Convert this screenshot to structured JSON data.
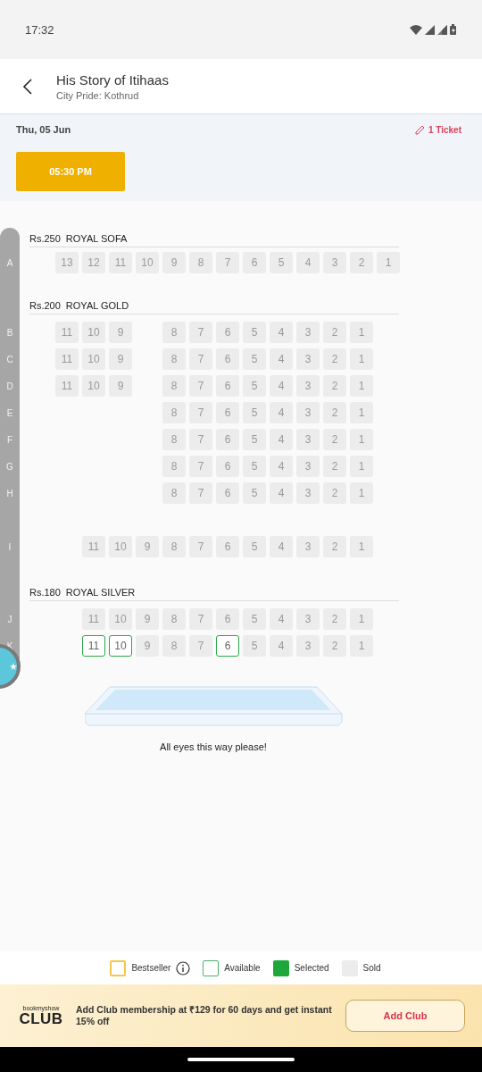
{
  "status_bar": {
    "time": "17:32"
  },
  "header": {
    "title": "His Story of Itihaas",
    "subtitle": "City Pride: Kothrud"
  },
  "show": {
    "date": "Thu, 05 Jun",
    "tickets": "1 Ticket",
    "showtimes": [
      {
        "time": "05:30 PM",
        "selected": true
      }
    ]
  },
  "sections": [
    {
      "price": "Rs.250",
      "name": "ROYAL SOFA",
      "rows": [
        {
          "kind": "seats",
          "letter": "A",
          "seats": [
            {
              "kind": "seat",
              "label": "13",
              "sold": true
            },
            {
              "kind": "seat",
              "label": "12",
              "sold": true
            },
            {
              "kind": "seat",
              "label": "11",
              "sold": true
            },
            {
              "kind": "seat",
              "label": "10",
              "sold": true
            },
            {
              "kind": "seat",
              "label": "9",
              "sold": true
            },
            {
              "kind": "seat",
              "label": "8",
              "sold": true
            },
            {
              "kind": "seat",
              "label": "7",
              "sold": true
            },
            {
              "kind": "seat",
              "label": "6",
              "sold": true
            },
            {
              "kind": "seat",
              "label": "5",
              "sold": true
            },
            {
              "kind": "seat",
              "label": "4",
              "sold": true
            },
            {
              "kind": "seat",
              "label": "3",
              "sold": true
            },
            {
              "kind": "seat",
              "label": "2",
              "sold": true
            },
            {
              "kind": "seat",
              "label": "1",
              "sold": true
            }
          ]
        }
      ]
    },
    {
      "price": "Rs.200",
      "name": "ROYAL GOLD",
      "rows": [
        {
          "kind": "seats",
          "letter": "B",
          "seats": [
            {
              "kind": "seat",
              "label": "11",
              "sold": true
            },
            {
              "kind": "seat",
              "label": "10",
              "sold": true
            },
            {
              "kind": "seat",
              "label": "9",
              "sold": true
            },
            {
              "kind": "gap"
            },
            {
              "kind": "seat",
              "label": "8",
              "sold": true
            },
            {
              "kind": "seat",
              "label": "7",
              "sold": true
            },
            {
              "kind": "seat",
              "label": "6",
              "sold": true
            },
            {
              "kind": "seat",
              "label": "5",
              "sold": true
            },
            {
              "kind": "seat",
              "label": "4",
              "sold": true
            },
            {
              "kind": "seat",
              "label": "3",
              "sold": true
            },
            {
              "kind": "seat",
              "label": "2",
              "sold": true
            },
            {
              "kind": "seat",
              "label": "1",
              "sold": true
            }
          ]
        },
        {
          "kind": "seats",
          "letter": "C",
          "seats": [
            {
              "kind": "seat",
              "label": "11",
              "sold": true
            },
            {
              "kind": "seat",
              "label": "10",
              "sold": true
            },
            {
              "kind": "seat",
              "label": "9",
              "sold": true
            },
            {
              "kind": "gap"
            },
            {
              "kind": "seat",
              "label": "8",
              "sold": true
            },
            {
              "kind": "seat",
              "label": "7",
              "sold": true
            },
            {
              "kind": "seat",
              "label": "6",
              "sold": true
            },
            {
              "kind": "seat",
              "label": "5",
              "sold": true
            },
            {
              "kind": "seat",
              "label": "4",
              "sold": true
            },
            {
              "kind": "seat",
              "label": "3",
              "sold": true
            },
            {
              "kind": "seat",
              "label": "2",
              "sold": true
            },
            {
              "kind": "seat",
              "label": "1",
              "sold": true
            }
          ]
        },
        {
          "kind": "seats",
          "letter": "D",
          "seats": [
            {
              "kind": "seat",
              "label": "11",
              "sold": true
            },
            {
              "kind": "seat",
              "label": "10",
              "sold": true
            },
            {
              "kind": "seat",
              "label": "9",
              "sold": true
            },
            {
              "kind": "gap"
            },
            {
              "kind": "seat",
              "label": "8",
              "sold": true
            },
            {
              "kind": "seat",
              "label": "7",
              "sold": true
            },
            {
              "kind": "seat",
              "label": "6",
              "sold": true
            },
            {
              "kind": "seat",
              "label": "5",
              "sold": true
            },
            {
              "kind": "seat",
              "label": "4",
              "sold": true
            },
            {
              "kind": "seat",
              "label": "3",
              "sold": true
            },
            {
              "kind": "seat",
              "label": "2",
              "sold": true
            },
            {
              "kind": "seat",
              "label": "1",
              "sold": true
            }
          ]
        },
        {
          "kind": "seats",
          "letter": "E",
          "seats": [
            {
              "kind": "gap"
            },
            {
              "kind": "gap"
            },
            {
              "kind": "gap"
            },
            {
              "kind": "gap"
            },
            {
              "kind": "seat",
              "label": "8",
              "sold": true
            },
            {
              "kind": "seat",
              "label": "7",
              "sold": true
            },
            {
              "kind": "seat",
              "label": "6",
              "sold": true
            },
            {
              "kind": "seat",
              "label": "5",
              "sold": true
            },
            {
              "kind": "seat",
              "label": "4",
              "sold": true
            },
            {
              "kind": "seat",
              "label": "3",
              "sold": true
            },
            {
              "kind": "seat",
              "label": "2",
              "sold": true
            },
            {
              "kind": "seat",
              "label": "1",
              "sold": true
            }
          ]
        },
        {
          "kind": "seats",
          "letter": "F",
          "seats": [
            {
              "kind": "gap"
            },
            {
              "kind": "gap"
            },
            {
              "kind": "gap"
            },
            {
              "kind": "gap"
            },
            {
              "kind": "seat",
              "label": "8",
              "sold": true
            },
            {
              "kind": "seat",
              "label": "7",
              "sold": true
            },
            {
              "kind": "seat",
              "label": "6",
              "sold": true
            },
            {
              "kind": "seat",
              "label": "5",
              "sold": true
            },
            {
              "kind": "seat",
              "label": "4",
              "sold": true
            },
            {
              "kind": "seat",
              "label": "3",
              "sold": true
            },
            {
              "kind": "seat",
              "label": "2",
              "sold": true
            },
            {
              "kind": "seat",
              "label": "1",
              "sold": true
            }
          ]
        },
        {
          "kind": "seats",
          "letter": "G",
          "seats": [
            {
              "kind": "gap"
            },
            {
              "kind": "gap"
            },
            {
              "kind": "gap"
            },
            {
              "kind": "gap"
            },
            {
              "kind": "seat",
              "label": "8",
              "sold": true
            },
            {
              "kind": "seat",
              "label": "7",
              "sold": true
            },
            {
              "kind": "seat",
              "label": "6",
              "sold": true
            },
            {
              "kind": "seat",
              "label": "5",
              "sold": true
            },
            {
              "kind": "seat",
              "label": "4",
              "sold": true
            },
            {
              "kind": "seat",
              "label": "3",
              "sold": true
            },
            {
              "kind": "seat",
              "label": "2",
              "sold": true
            },
            {
              "kind": "seat",
              "label": "1",
              "sold": true
            }
          ]
        },
        {
          "kind": "seats",
          "letter": "H",
          "seats": [
            {
              "kind": "gap"
            },
            {
              "kind": "gap"
            },
            {
              "kind": "gap"
            },
            {
              "kind": "gap"
            },
            {
              "kind": "seat",
              "label": "8",
              "sold": true
            },
            {
              "kind": "seat",
              "label": "7",
              "sold": true
            },
            {
              "kind": "seat",
              "label": "6",
              "sold": true
            },
            {
              "kind": "seat",
              "label": "5",
              "sold": true
            },
            {
              "kind": "seat",
              "label": "4",
              "sold": true
            },
            {
              "kind": "seat",
              "label": "3",
              "sold": true
            },
            {
              "kind": "seat",
              "label": "2",
              "sold": true
            },
            {
              "kind": "seat",
              "label": "1",
              "sold": true
            }
          ]
        },
        {
          "kind": "blank"
        },
        {
          "kind": "seats",
          "letter": "I",
          "seats": [
            {
              "kind": "gap"
            },
            {
              "kind": "seat",
              "label": "11",
              "sold": true
            },
            {
              "kind": "seat",
              "label": "10",
              "sold": true
            },
            {
              "kind": "seat",
              "label": "9",
              "sold": true
            },
            {
              "kind": "seat",
              "label": "8",
              "sold": true
            },
            {
              "kind": "seat",
              "label": "7",
              "sold": true
            },
            {
              "kind": "seat",
              "label": "6",
              "sold": true
            },
            {
              "kind": "seat",
              "label": "5",
              "sold": true
            },
            {
              "kind": "seat",
              "label": "4",
              "sold": true
            },
            {
              "kind": "seat",
              "label": "3",
              "sold": true
            },
            {
              "kind": "seat",
              "label": "2",
              "sold": true
            },
            {
              "kind": "seat",
              "label": "1",
              "sold": true
            }
          ]
        }
      ]
    },
    {
      "price": "Rs.180",
      "name": "ROYAL SILVER",
      "rows": [
        {
          "kind": "seats",
          "letter": "J",
          "seats": [
            {
              "kind": "gap"
            },
            {
              "kind": "seat",
              "label": "11",
              "sold": true
            },
            {
              "kind": "seat",
              "label": "10",
              "sold": true
            },
            {
              "kind": "seat",
              "label": "9",
              "sold": true
            },
            {
              "kind": "seat",
              "label": "8",
              "sold": true
            },
            {
              "kind": "seat",
              "label": "7",
              "sold": true
            },
            {
              "kind": "seat",
              "label": "6",
              "sold": true
            },
            {
              "kind": "seat",
              "label": "5",
              "sold": true
            },
            {
              "kind": "seat",
              "label": "4",
              "sold": true
            },
            {
              "kind": "seat",
              "label": "3",
              "sold": true
            },
            {
              "kind": "seat",
              "label": "2",
              "sold": true
            },
            {
              "kind": "seat",
              "label": "1",
              "sold": true
            }
          ]
        },
        {
          "kind": "seats",
          "letter": "K",
          "seats": [
            {
              "kind": "gap"
            },
            {
              "kind": "seat",
              "label": "11",
              "sold": false
            },
            {
              "kind": "seat",
              "label": "10",
              "sold": false
            },
            {
              "kind": "seat",
              "label": "9",
              "sold": true
            },
            {
              "kind": "seat",
              "label": "8",
              "sold": true
            },
            {
              "kind": "seat",
              "label": "7",
              "sold": true
            },
            {
              "kind": "seat",
              "label": "6",
              "sold": false
            },
            {
              "kind": "seat",
              "label": "5",
              "sold": true
            },
            {
              "kind": "seat",
              "label": "4",
              "sold": true
            },
            {
              "kind": "seat",
              "label": "3",
              "sold": true
            },
            {
              "kind": "seat",
              "label": "2",
              "sold": true
            },
            {
              "kind": "seat",
              "label": "1",
              "sold": true
            }
          ]
        }
      ]
    }
  ],
  "screen": {
    "caption": "All eyes this way please!"
  },
  "legend": [
    {
      "kind": "bestseller",
      "label": "Bestseller",
      "info": true
    },
    {
      "kind": "available",
      "label": "Available",
      "info": false
    },
    {
      "kind": "selected",
      "label": "Selected",
      "info": false
    },
    {
      "kind": "sold",
      "label": "Sold",
      "info": false
    }
  ],
  "club": {
    "brand": "bookmyshow",
    "logo": "CLUB",
    "message": "Add Club membership at ₹129 for 60 days and get instant 15% off",
    "button": "Add Club"
  }
}
